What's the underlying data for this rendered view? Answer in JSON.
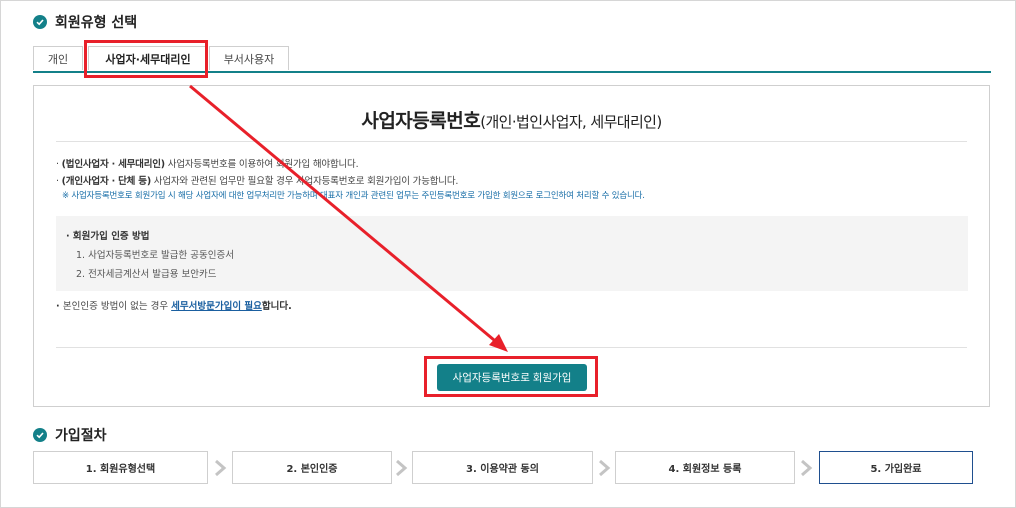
{
  "section_member_type": {
    "title": "회원유형 선택"
  },
  "tabs": [
    {
      "label": "개인",
      "active": false
    },
    {
      "label": "사업자·세무대리인",
      "active": true
    },
    {
      "label": "부서사용자",
      "active": false
    }
  ],
  "panel": {
    "title_main": "사업자등록번호",
    "title_sub": "(개인·법인사업자, 세무대리인)",
    "bullet1_bold": "(법인사업자 · 세무대리인)",
    "bullet1_text": " 사업자등록번호를 이용하여 회원가입 해야합니다.",
    "bullet2_bold": "(개인사업자 · 단체 등)",
    "bullet2_text": " 사업자와 관련된 업무만 필요할 경우 사업자등록번호로 회원가입이 가능합니다.",
    "note": "※ 사업자등록번호로 회원가입 시 해당 사업자에 대한 업무처리만 가능하며 대표자 개인과 관련된 업무는 주민등록번호로 가입한 회원으로 로그인하여 처리할 수 있습니다.",
    "auth_title": "회원가입 인증 방법",
    "auth_items": [
      "1. 사업자등록번호로 발급한 공동인증서",
      "2. 전자세금계산서 발급용 보안카드"
    ],
    "no_auth_prefix": "본인인증 방법이 없는 경우 ",
    "no_auth_link": "세무서방문가입이 필요",
    "no_auth_suffix": "합니다.",
    "join_button": "사업자등록번호로 회원가입"
  },
  "section_procedure": {
    "title": "가입절차"
  },
  "steps": [
    "1. 회원유형선택",
    "2. 본인인증",
    "3. 이용약관 동의",
    "4. 회원정보 등록",
    "5. 가입완료"
  ],
  "colors": {
    "accent": "#138089",
    "highlight": "#e8202a",
    "link": "#1a5fa0"
  }
}
